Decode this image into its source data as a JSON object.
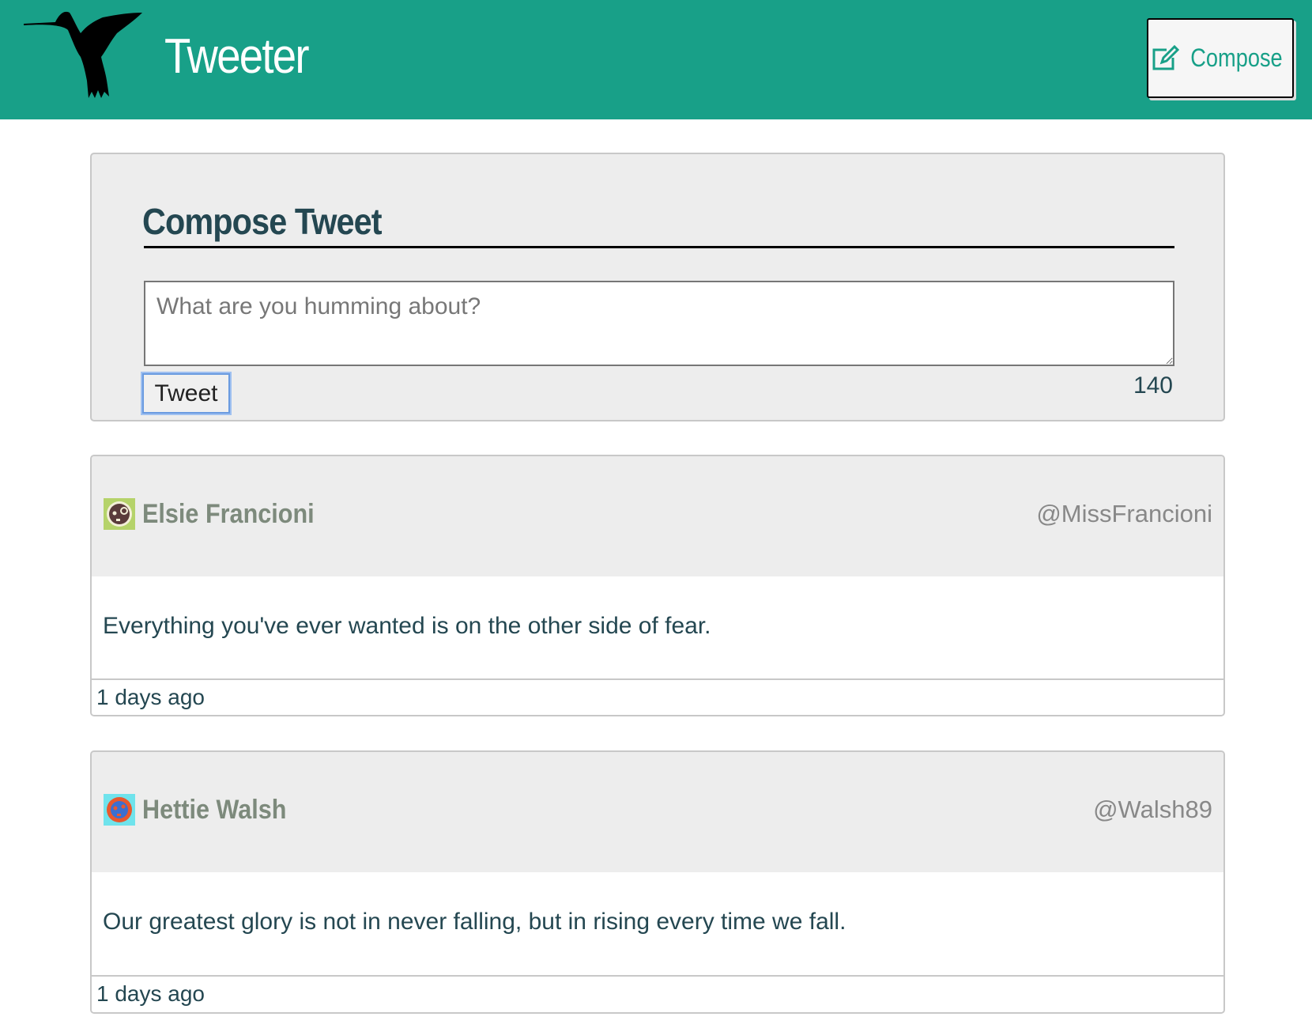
{
  "nav": {
    "brand": "Tweeter",
    "compose_label": "Compose",
    "logo": "hummingbird-logo",
    "compose_icon": "edit-icon",
    "color": "#18a088"
  },
  "new_tweet": {
    "title": "Compose Tweet",
    "placeholder": "What are you humming about?",
    "value": "",
    "button": "Tweet",
    "counter": "140"
  },
  "tweets": [
    {
      "name": "Elsie Francioni",
      "handle": "@MissFrancioni",
      "text": "Everything you've ever wanted is on the other side of fear.",
      "time": "1 days ago",
      "avatar_bg": "#b5d36a",
      "avatar_fg": "#5a3b3b"
    },
    {
      "name": "Hettie Walsh",
      "handle": "@Walsh89",
      "text": "Our greatest glory is not in never falling, but in rising every time we fall.",
      "time": "1 days ago",
      "avatar_bg": "#6fe3ec",
      "avatar_fg": "#e8582e"
    }
  ]
}
